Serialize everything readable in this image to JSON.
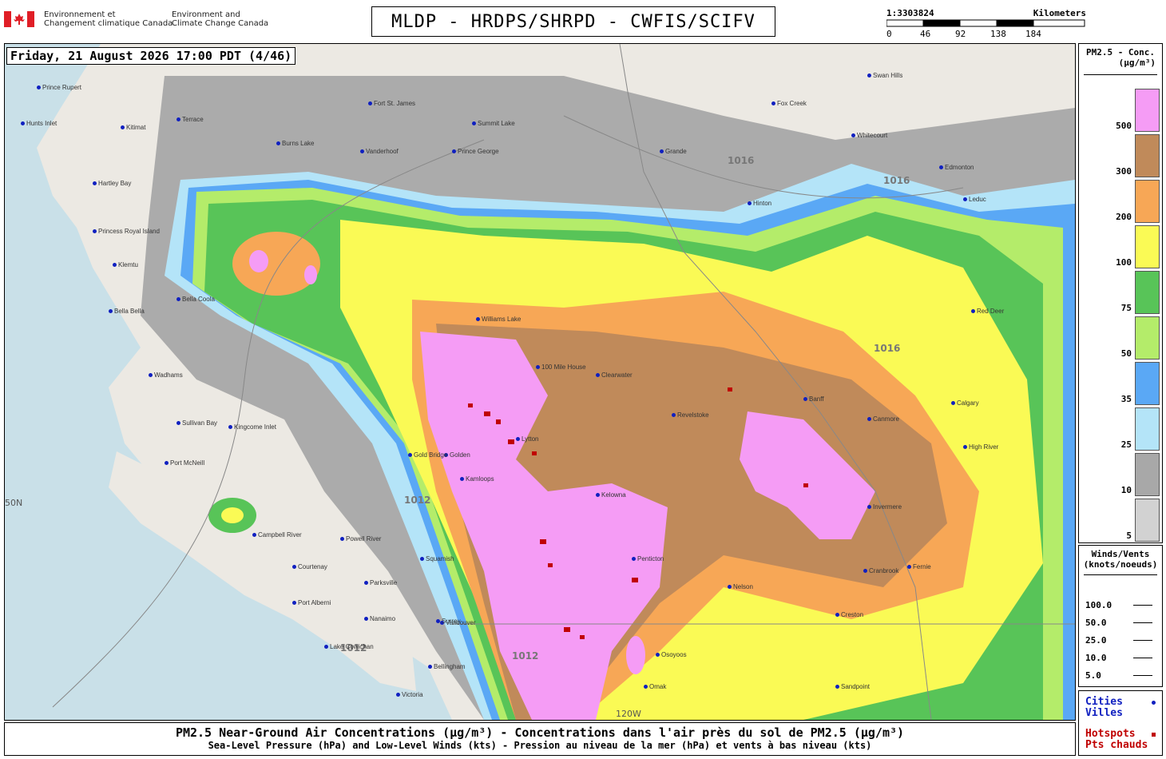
{
  "header": {
    "agency_fr": "Environnement et\nChangement climatique Canada",
    "agency_en": "Environment and\nClimate Change Canada",
    "title": "MLDP - HRDPS/SHRPD - CWFIS/SCIFV"
  },
  "scale": {
    "ratio": "1:3303824",
    "unit": "Kilometers",
    "ticks": [
      "0",
      "46",
      "92",
      "138",
      "184"
    ]
  },
  "timestamp": "Friday, 21 August 2026 17:00 PDT (4/46)",
  "legend_pm": {
    "title_line1": "PM2.5 - Conc.",
    "title_line2": "(µg/m³)",
    "levels": [
      {
        "label": "500",
        "color": "#f59cf5"
      },
      {
        "label": "300",
        "color": "#c08a5a"
      },
      {
        "label": "200",
        "color": "#f7a756"
      },
      {
        "label": "100",
        "color": "#fafa55"
      },
      {
        "label": "75",
        "color": "#58c458"
      },
      {
        "label": "50",
        "color": "#b4ec6a"
      },
      {
        "label": "35",
        "color": "#5aa8f5"
      },
      {
        "label": "25",
        "color": "#b4e4f8"
      },
      {
        "label": "10",
        "color": "#a8a8a8"
      },
      {
        "label": "5",
        "color": "#d2d2d2"
      }
    ]
  },
  "legend_wind": {
    "title_line1": "Winds/Vents",
    "title_line2": "(knots/noeuds)",
    "rows": [
      "100.0",
      "50.0",
      "25.0",
      "10.0",
      "5.0"
    ]
  },
  "legend_pts": {
    "cities_en": "Cities",
    "cities_fr": "Villes",
    "hotspots_en": "Hotspots",
    "hotspots_fr": "Pts chauds"
  },
  "footer": {
    "line1": "PM2.5 Near-Ground Air Concentrations (µg/m³) - Concentrations dans l'air près du sol de PM2.5 (µg/m³)",
    "line2": "Sea-Level Pressure (hPa) and Low-Level Winds (kts) - Pression au niveau de la mer (hPa) et vents à bas niveau (kts)"
  },
  "map": {
    "isobar_labels": [
      "1016",
      "1012"
    ],
    "lat_label": "50N",
    "lon_label": "120W",
    "places": [
      {
        "name": "Prince Rupert"
      },
      {
        "name": "Hunts Inlet"
      },
      {
        "name": "Kitimat"
      },
      {
        "name": "Terrace"
      },
      {
        "name": "Burns Lake"
      },
      {
        "name": "Fort St. James"
      },
      {
        "name": "Vanderhoof"
      },
      {
        "name": "Prince George"
      },
      {
        "name": "Summit Lake"
      },
      {
        "name": "Grande"
      },
      {
        "name": "Hinton"
      },
      {
        "name": "Hartley Bay"
      },
      {
        "name": "Princess Royal Island"
      },
      {
        "name": "Klemtu"
      },
      {
        "name": "Bella Bella"
      },
      {
        "name": "Bella Coola"
      },
      {
        "name": "Williams Lake"
      },
      {
        "name": "Kamloops"
      },
      {
        "name": "100 Mile House"
      },
      {
        "name": "Clearwater"
      },
      {
        "name": "Revelstoke"
      },
      {
        "name": "Golden"
      },
      {
        "name": "Kelowna"
      },
      {
        "name": "Penticton"
      },
      {
        "name": "Osoyoos"
      },
      {
        "name": "Nelson"
      },
      {
        "name": "Cranbrook"
      },
      {
        "name": "Creston"
      },
      {
        "name": "Banff"
      },
      {
        "name": "Canmore"
      },
      {
        "name": "Invermere"
      },
      {
        "name": "Calgary"
      },
      {
        "name": "Red Deer"
      },
      {
        "name": "Edmonton"
      },
      {
        "name": "Leduc"
      },
      {
        "name": "High River"
      },
      {
        "name": "Fernie"
      },
      {
        "name": "Vancouver"
      },
      {
        "name": "Surrey"
      },
      {
        "name": "Bellingham"
      },
      {
        "name": "Nanaimo"
      },
      {
        "name": "Parksville"
      },
      {
        "name": "Port Alberni"
      },
      {
        "name": "Courtenay"
      },
      {
        "name": "Campbell River"
      },
      {
        "name": "Powell River"
      },
      {
        "name": "Port McNeill"
      },
      {
        "name": "Sullivan Bay"
      },
      {
        "name": "Kingcome Inlet"
      },
      {
        "name": "Wadhams"
      },
      {
        "name": "Lake Cowichan"
      },
      {
        "name": "Victoria"
      },
      {
        "name": "Squamish"
      },
      {
        "name": "Whitecourt"
      },
      {
        "name": "Swan Hills"
      },
      {
        "name": "Fox Creek"
      },
      {
        "name": "Gold Bridge"
      },
      {
        "name": "Lytton"
      },
      {
        "name": "Sandpoint"
      },
      {
        "name": "Omak"
      }
    ]
  }
}
